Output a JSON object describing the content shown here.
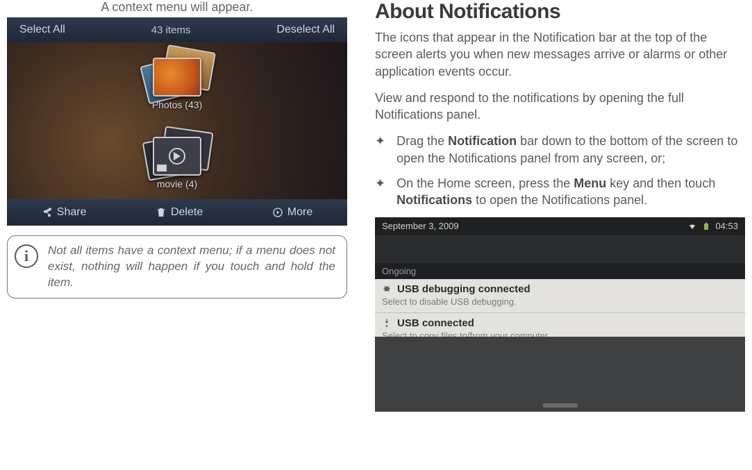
{
  "left": {
    "caption": "A context menu will appear.",
    "gallery_top": {
      "select_all": "Select All",
      "count_label": "43 items",
      "deselect_all": "Deselect All"
    },
    "gallery_stacks": {
      "photos_label": "Photos  (43)",
      "movie_label": "movie  (4)"
    },
    "gallery_bottom": {
      "share": "Share",
      "delete": "Delete",
      "more": "More"
    },
    "infobox": "Not all items have a context menu; if a menu does not exist, nothing will happen if you touch and hold the item."
  },
  "right": {
    "heading": "About Notifications",
    "para1": "The icons that appear in the Notification bar at the top of the screen alerts you when new messages arrive or alarms or other application events occur.",
    "para2": "View and respond to the notifications by opening the full Notifications panel.",
    "bullets": [
      {
        "pre": "Drag the ",
        "bold1": "Notification",
        "post": " bar down to the bottom of the screen to open the Notifications panel from any screen, or;"
      },
      {
        "pre": "On the Home screen, press the ",
        "bold1": "Menu",
        "mid": " key and then touch ",
        "bold2": "Notifications",
        "post": " to open the Notifications panel."
      }
    ],
    "notif_shot": {
      "date": "September 3, 2009",
      "time": "04:53",
      "ongoing": "Ongoing",
      "items": [
        {
          "title": "USB debugging connected",
          "sub": "Select to disable USB debugging."
        },
        {
          "title": "USB connected",
          "sub": "Select to copy files to/from your computer."
        }
      ]
    }
  }
}
